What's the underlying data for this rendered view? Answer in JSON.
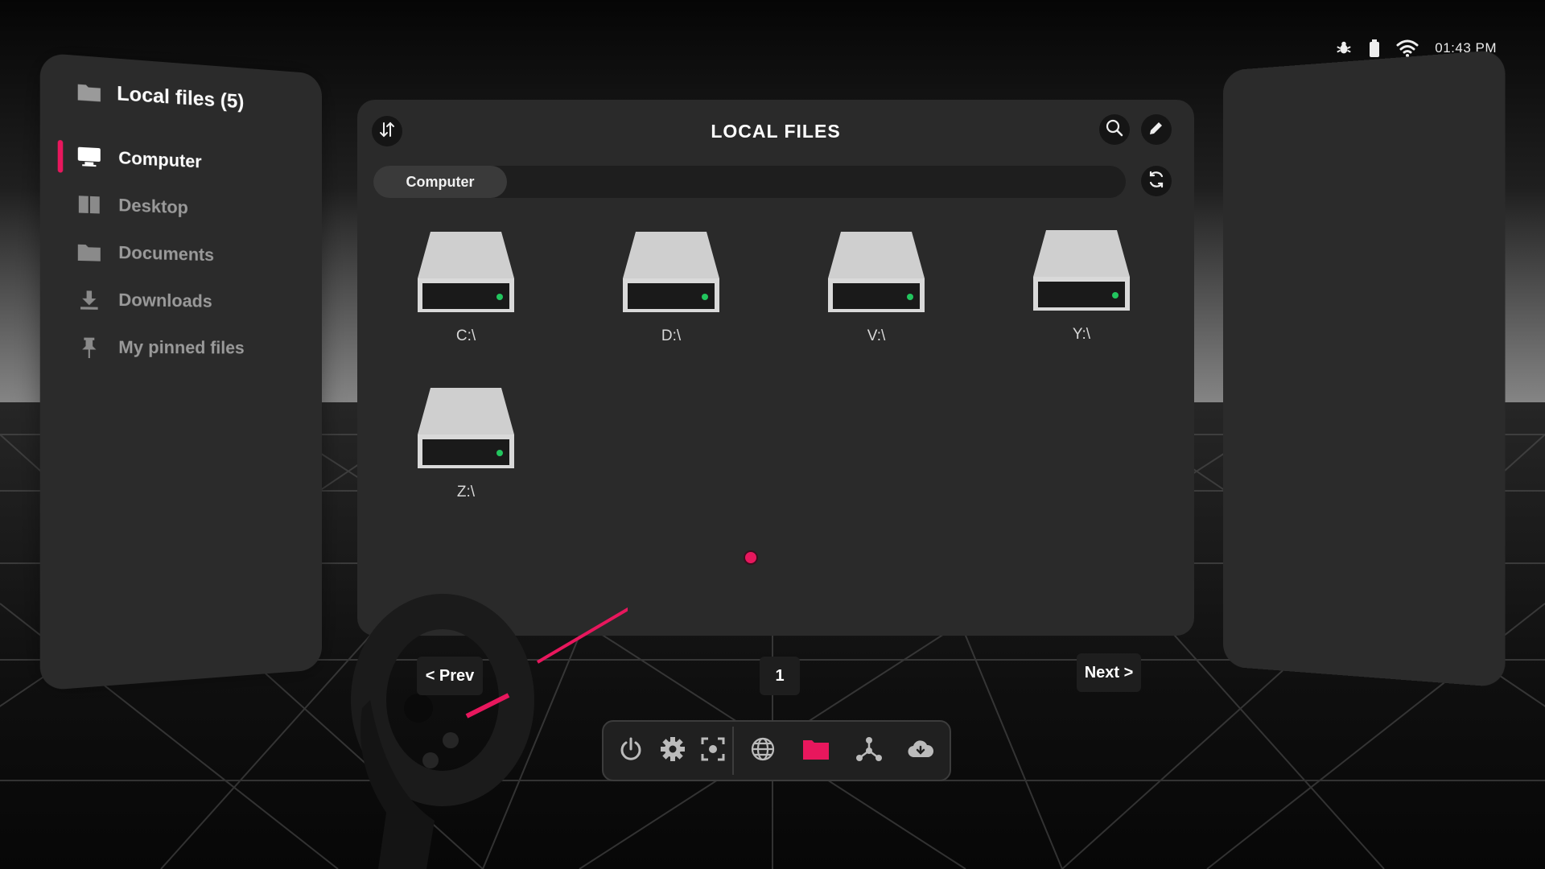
{
  "status": {
    "time": "01:43 PM",
    "icons": [
      "bug-icon",
      "battery-icon",
      "wifi-icon"
    ]
  },
  "sidebar": {
    "title": "Local files (5)",
    "items": [
      {
        "label": "Computer",
        "icon": "monitor-icon",
        "active": true
      },
      {
        "label": "Desktop",
        "icon": "desktop-icon",
        "active": false
      },
      {
        "label": "Documents",
        "icon": "folder-icon",
        "active": false
      },
      {
        "label": "Downloads",
        "icon": "download-icon",
        "active": false
      },
      {
        "label": "My pinned files",
        "icon": "pin-icon",
        "active": false
      }
    ]
  },
  "main": {
    "title": "LOCAL FILES",
    "breadcrumb": [
      "Computer"
    ],
    "drives": [
      {
        "label": "C:\\"
      },
      {
        "label": "D:\\"
      },
      {
        "label": "V:\\"
      },
      {
        "label": "Y:\\"
      },
      {
        "label": "Z:\\"
      }
    ]
  },
  "pagination": {
    "prev": "< Prev",
    "page": "1",
    "next": "Next >"
  },
  "dock": {
    "items": [
      "power-icon",
      "settings-icon",
      "screenshot-icon",
      "globe-icon",
      "folder-icon",
      "network-icon",
      "cloud-download-icon"
    ],
    "active": "folder-icon"
  },
  "colors": {
    "accent": "#e8175d",
    "panel": "#2a2a2a",
    "drive_led": "#22c55e"
  }
}
